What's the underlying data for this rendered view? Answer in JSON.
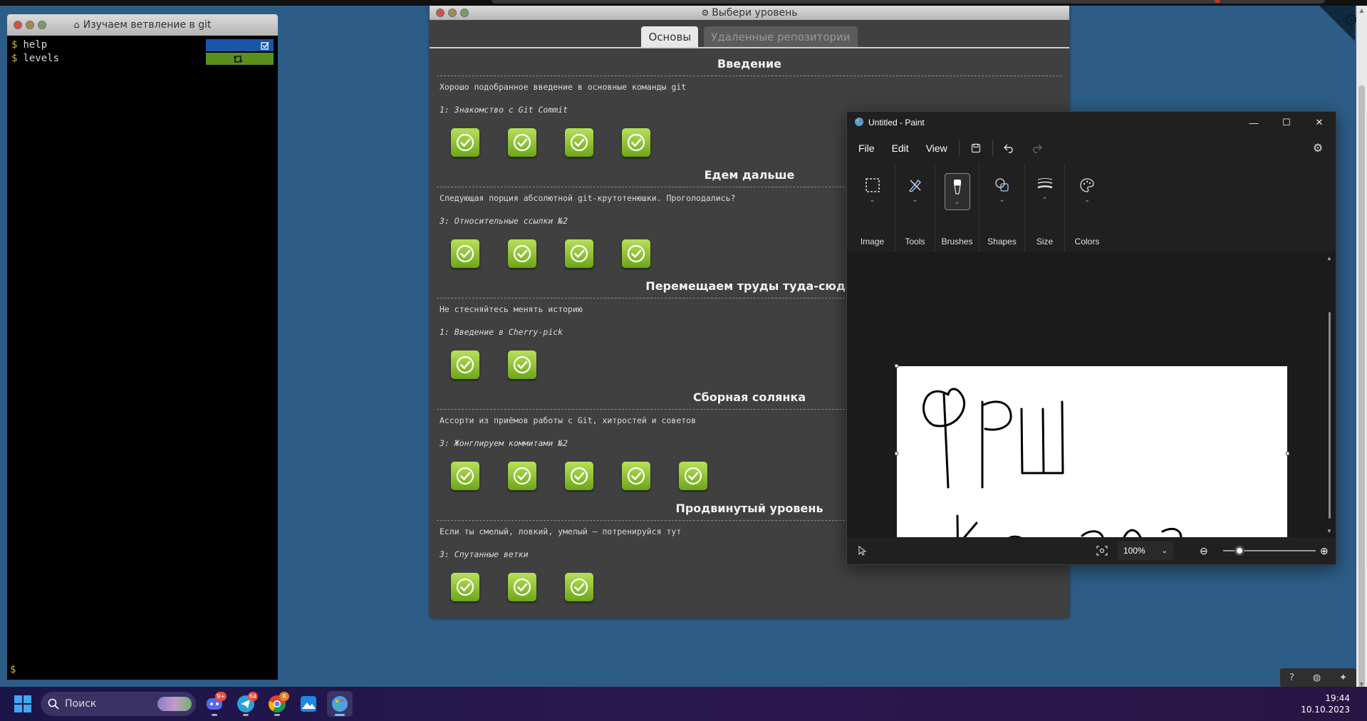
{
  "terminal": {
    "title": "Изучаем ветвление в git",
    "lines": [
      {
        "prompt": "$",
        "command": "help"
      },
      {
        "prompt": "$",
        "command": "levels"
      }
    ],
    "prompt_bottom": "$"
  },
  "levels_dialog": {
    "title": "Выбери уровень",
    "tabs": [
      {
        "label": "Основы",
        "active": true
      },
      {
        "label": "Удаленные репозитории",
        "active": false
      }
    ],
    "sections": [
      {
        "title": "Введение",
        "description": "Хорошо подобранное введение в основные команды git",
        "current": "1: Знакомство с Git Commit",
        "level_count": 4
      },
      {
        "title": "Едем дальше",
        "description": "Следующая порция абсолютной git-крутотенюшки. Проголодались?",
        "current": "3: Относительные ссылки №2",
        "level_count": 4
      },
      {
        "title": "Перемещаем труды туда-сюда",
        "description": "Не стесняйтесь менять историю",
        "current": "1: Введение в Cherry-pick",
        "level_count": 2
      },
      {
        "title": "Сборная солянка",
        "description": "Ассорти из приёмов работы с Git, хитростей и советов",
        "current": "3: Жонглируем коммитами №2",
        "level_count": 5
      },
      {
        "title": "Продвинутый уровень",
        "description": "Если ты смелый, ловкий, умелый – потренируйся тут",
        "current": "3: Спутанные ветки",
        "level_count": 3
      }
    ]
  },
  "paint": {
    "title": "Untitled - Paint",
    "menu": [
      "File",
      "Edit",
      "View"
    ],
    "ribbon": [
      "Image",
      "Tools",
      "Brushes",
      "Shapes",
      "Size",
      "Colors"
    ],
    "zoom": "100%"
  },
  "taskbar": {
    "search_placeholder": "Поиск",
    "badges": {
      "discord": "9+",
      "telegram": "64",
      "chrome": "R"
    },
    "time": "19:44",
    "date": "10.10.2023"
  },
  "colors": {
    "desktop": "#2d5d86",
    "level_done": "#8cc63f",
    "paint_bg": "#202020"
  }
}
